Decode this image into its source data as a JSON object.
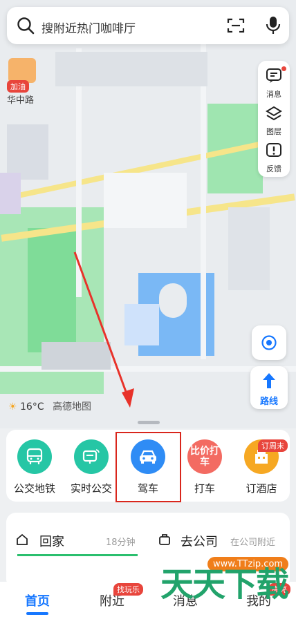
{
  "search": {
    "placeholder": "搜附近热门咖啡厅"
  },
  "map": {
    "pin_badge": "加油",
    "road_label": "华中路",
    "right_panel": [
      {
        "label": "消息",
        "icon": "message-icon"
      },
      {
        "label": "图层",
        "icon": "layers-icon"
      },
      {
        "label": "反馈",
        "icon": "feedback-icon"
      }
    ],
    "route_label": "路线",
    "weather": {
      "temp": "16°C",
      "brand": "高德地图"
    }
  },
  "quick_actions": [
    {
      "label": "公交地铁",
      "icon": "bus-icon",
      "color": "#26c6a5"
    },
    {
      "label": "实时公交",
      "icon": "realtime-bus-icon",
      "color": "#26c6a5"
    },
    {
      "label": "驾车",
      "icon": "car-icon",
      "color": "#2f8cf5"
    },
    {
      "label": "打车",
      "icon": "taxi-icon",
      "color": "#f36b62",
      "icon_text": "比价打车"
    },
    {
      "label": "订酒店",
      "icon": "hotel-icon",
      "color": "#f6a823",
      "badge": "订周末"
    }
  ],
  "commute": {
    "home": {
      "label": "回家",
      "time": "18分钟"
    },
    "work": {
      "label": "去公司",
      "hint": "在公司附近"
    }
  },
  "bottom_nav": [
    {
      "label": "首页",
      "active": true
    },
    {
      "label": "附近",
      "badge": "找玩乐"
    },
    {
      "label": "消息"
    },
    {
      "label": "我的",
      "badge": "亮亮"
    }
  ],
  "watermark": {
    "site": "www.TTzip.com",
    "brand": "天天下载"
  },
  "colors": {
    "accent": "#1677ff",
    "highlight": "#d9261c",
    "map_green": "#8fe0a6",
    "map_blue": "#7ab8f5"
  }
}
